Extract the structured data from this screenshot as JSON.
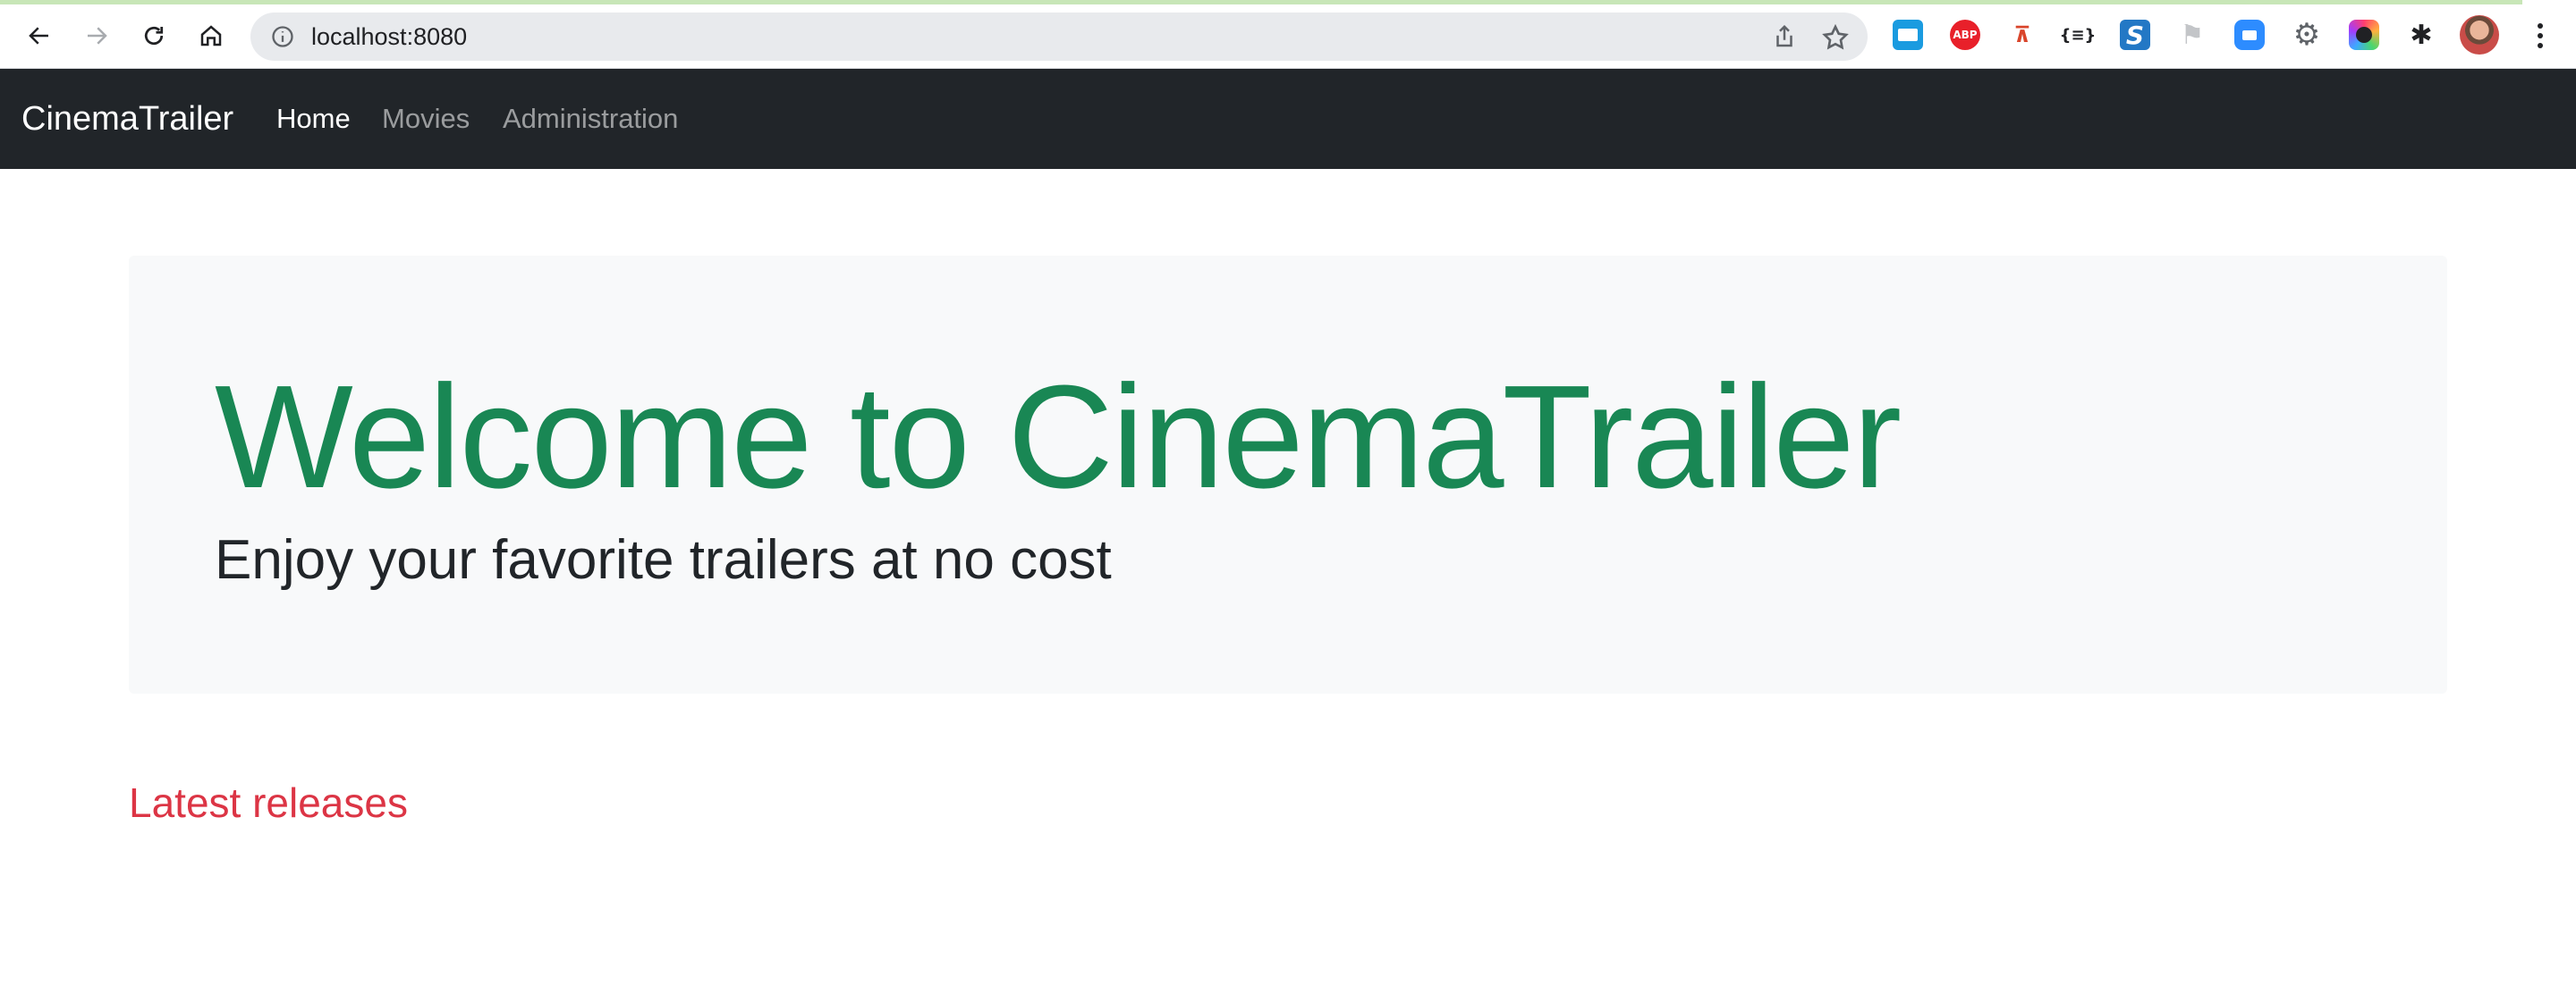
{
  "browser": {
    "url": "localhost:8080",
    "extensions": [
      "window-extension-icon",
      "adblock-plus-icon",
      "sitemap-extension-icon",
      "json-formatter-icon",
      "s-extension-icon",
      "flag-extension-icon",
      "zoom-extension-icon",
      "gear-extension-icon",
      "color-picker-extension-icon",
      "extensions-puzzle-icon"
    ],
    "extension_glyphs": {
      "adblock": "ABP",
      "json": "{≡}",
      "s": "S"
    }
  },
  "navbar": {
    "brand": "CinemaTrailer",
    "links": [
      {
        "label": "Home",
        "active": true
      },
      {
        "label": "Movies",
        "active": false
      },
      {
        "label": "Administration",
        "active": false
      }
    ],
    "background": "#212529"
  },
  "hero": {
    "title": "Welcome to CinemaTrailer",
    "subtitle": "Enjoy your favorite trailers at no cost",
    "title_color": "#198754"
  },
  "latest": {
    "heading": "Latest releases",
    "heading_color": "#dc3545"
  }
}
